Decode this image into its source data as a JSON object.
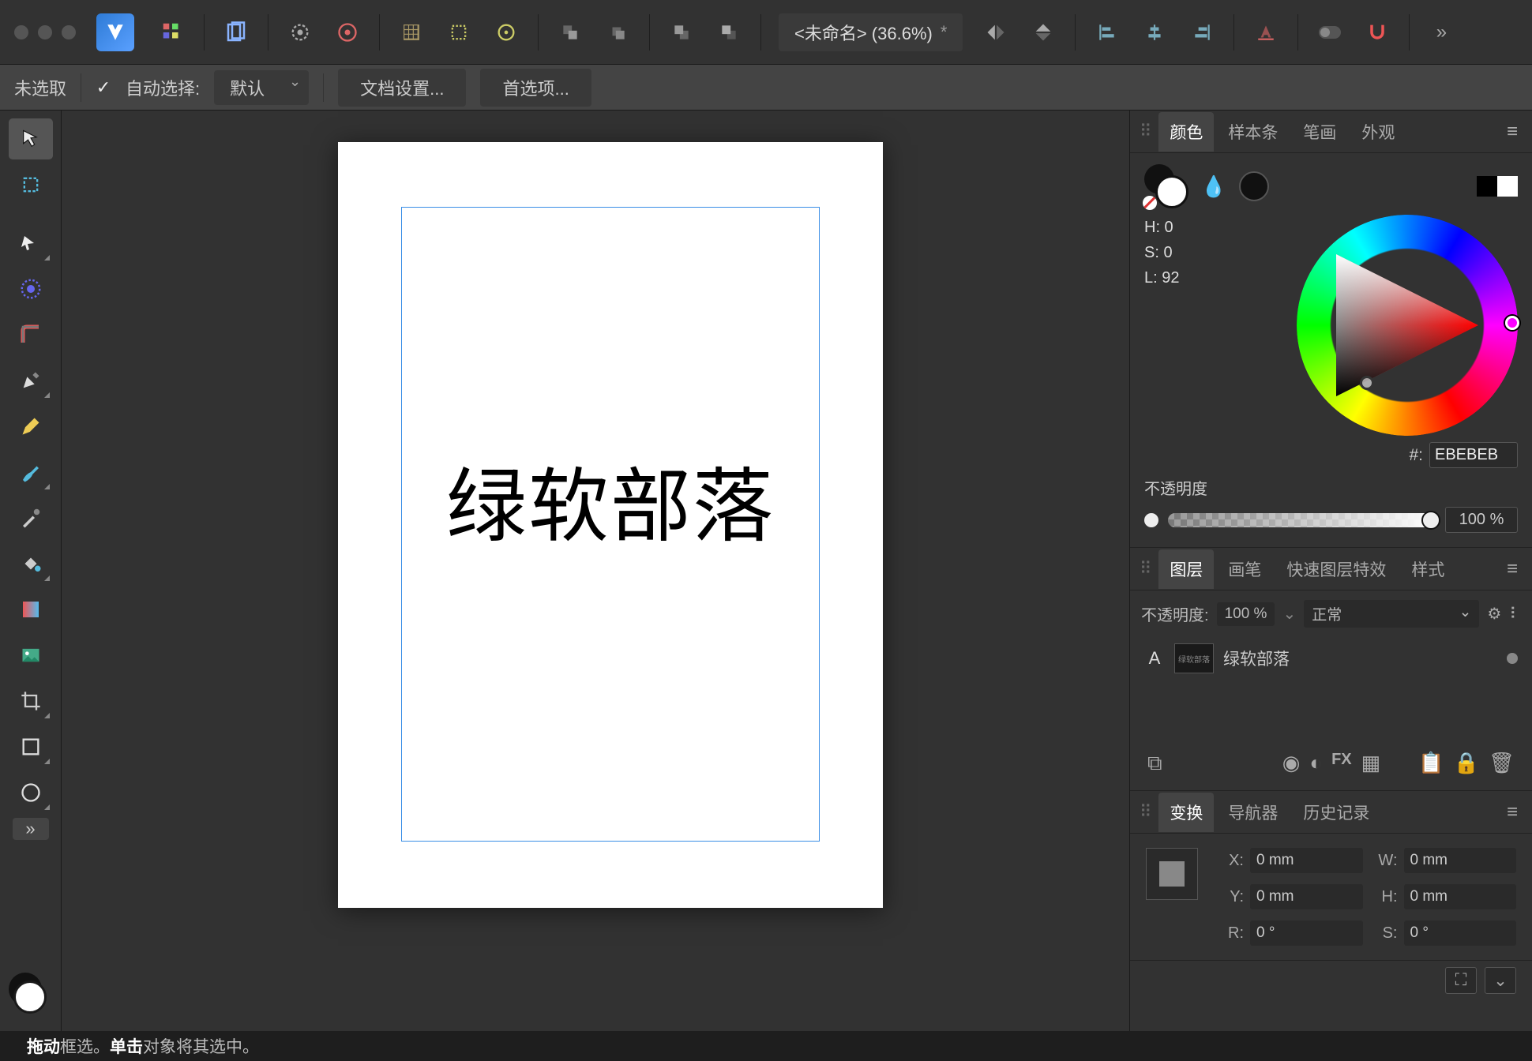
{
  "document": {
    "title": "<未命名> (36.6%)",
    "dirty": "*"
  },
  "context_bar": {
    "selection": "未选取",
    "auto_select_label": "自动选择:",
    "auto_select_mode": "默认",
    "doc_settings": "文档设置...",
    "preferences": "首选项..."
  },
  "canvas": {
    "text": "绿软部落"
  },
  "panels": {
    "color": {
      "tabs": [
        "颜色",
        "样本条",
        "笔画",
        "外观"
      ],
      "H": "H: 0",
      "S": "S: 0",
      "L": "L: 92",
      "hex_prefix": "#:",
      "hex": "EBEBEB",
      "opacity_label": "不透明度",
      "opacity_value": "100 %"
    },
    "layers": {
      "tabs": [
        "图层",
        "画笔",
        "快速图层特效",
        "样式"
      ],
      "opacity_label": "不透明度:",
      "opacity_value": "100 %",
      "blend_mode": "正常",
      "items": [
        {
          "type": "A",
          "thumb": "绿软部落",
          "name": "绿软部落"
        }
      ]
    },
    "transform": {
      "tabs": [
        "变换",
        "导航器",
        "历史记录"
      ],
      "X_label": "X:",
      "X": "0 mm",
      "Y_label": "Y:",
      "Y": "0 mm",
      "W_label": "W:",
      "W": "0 mm",
      "H_label": "H:",
      "H": "0 mm",
      "R_label": "R:",
      "R": "0 °",
      "S_label": "S:",
      "S": "0 °"
    }
  },
  "status": {
    "drag": "拖动",
    "drag_txt": " 框选。",
    "click": "单击",
    "click_txt": " 对象将其选中。"
  }
}
